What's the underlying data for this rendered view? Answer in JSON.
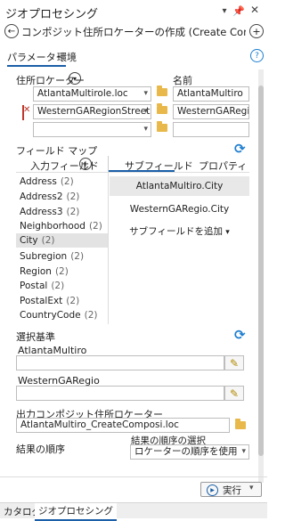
{
  "pane": {
    "title": "ジオプロセシング",
    "pin_icon": "pin-icon",
    "close_icon": "close-icon",
    "menu_icon": "menu-icon"
  },
  "tool": {
    "title": "コンポジット住所ロケーターの作成 (Create Compo..."
  },
  "tabs": {
    "parameters": "パラメーター",
    "environments": "環境"
  },
  "locators": {
    "label": "住所ロケーター",
    "name_header": "名前",
    "rows": [
      {
        "locator": "AtlantaMultirole.loc",
        "name": "AtlantaMultiro"
      },
      {
        "locator": "WesternGARegionStreets.lc",
        "name": "WesternGARegio"
      },
      {
        "locator": "",
        "name": ""
      }
    ]
  },
  "field_map": {
    "label": "フィールド マップ",
    "input_fields_header": "入力フィールド",
    "subfields_header": "サブフィールド",
    "properties_header": "プロパティ",
    "fields": [
      {
        "name": "Address",
        "count": "(2)"
      },
      {
        "name": "Address2",
        "count": "(2)"
      },
      {
        "name": "Address3",
        "count": "(2)"
      },
      {
        "name": "Neighborhood",
        "count": "(2)"
      },
      {
        "name": "City",
        "count": "(2)"
      },
      {
        "name": "Subregion",
        "count": "(2)"
      },
      {
        "name": "Region",
        "count": "(2)"
      },
      {
        "name": "Postal",
        "count": "(2)"
      },
      {
        "name": "PostalExt",
        "count": "(2)"
      },
      {
        "name": "CountryCode",
        "count": "(2)"
      }
    ],
    "subfields": [
      "AtlantaMultiro.City",
      "WesternGARegio.City"
    ],
    "add_subfield": "サブフィールドを追加"
  },
  "selection": {
    "label": "選択基準",
    "items": [
      {
        "label": "AtlantaMultiro",
        "value": ""
      },
      {
        "label": "WesternGARegio",
        "value": ""
      }
    ]
  },
  "output": {
    "label": "出力コンポジット住所ロケーター",
    "value": "AtlantaMultiro_CreateComposi.loc"
  },
  "order": {
    "label": "結果の順序",
    "select_label": "結果の順序の選択",
    "value": "ロケーターの順序を使用"
  },
  "run": {
    "label": "実行"
  },
  "bottom_tabs": {
    "catalog": "カタログ",
    "geoprocessing": "ジオプロセシング"
  },
  "colors": {
    "accent": "#1a5fa8",
    "selected_row": "#e3e3e3",
    "folder": "#e8b84a",
    "remove": "#c0392b"
  }
}
